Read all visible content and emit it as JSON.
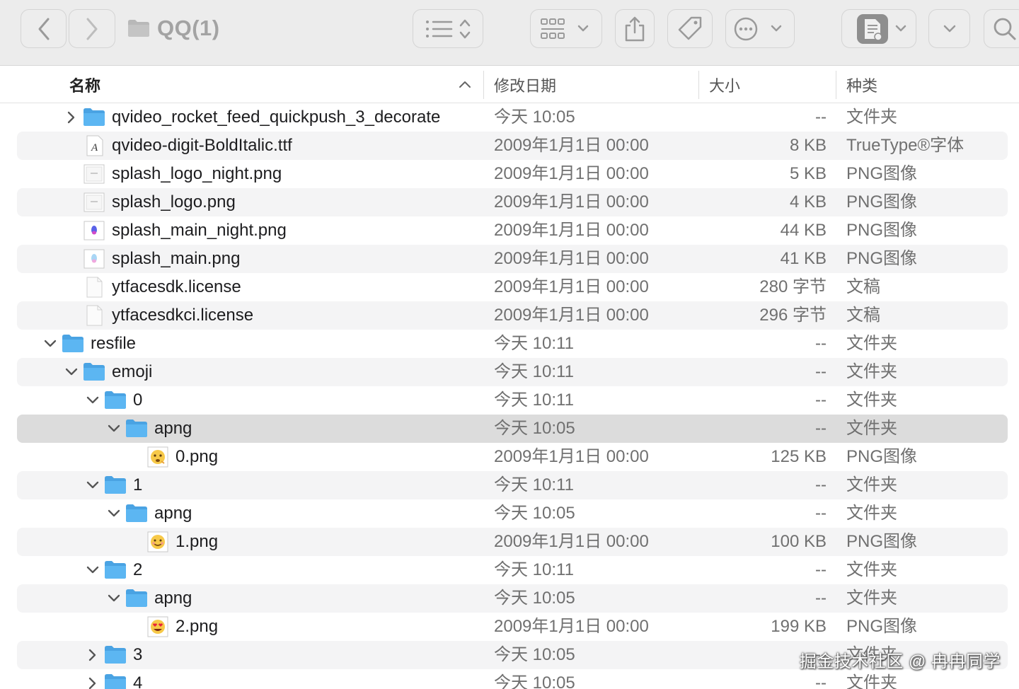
{
  "window": {
    "title": "QQ(1)",
    "toolbar": {
      "back_icon": "chevron-left-icon",
      "forward_icon": "chevron-right-icon",
      "view_icon": "list-view-icon",
      "group_icon": "grid-icon",
      "share_icon": "share-icon",
      "tag_icon": "tag-icon",
      "more_icon": "ellipsis-icon",
      "preview_icon": "document-preview-icon",
      "search_icon": "search-icon"
    }
  },
  "columns": {
    "name": "名称",
    "date": "修改日期",
    "size": "大小",
    "kind": "种类"
  },
  "colors": {
    "folder": "#5cb6f2",
    "folder_tab": "#4aa3e3",
    "selection": "#dcdcdc",
    "alt_row": "#f4f4f5"
  },
  "rows": [
    {
      "name": "qvideo_rocket_feed_quickpush_3_decorate",
      "date": "今天 10:05",
      "size": "--",
      "kind": "文件夹",
      "level": 2,
      "icon": "folder",
      "disclosure": "collapsed"
    },
    {
      "name": "qvideo-digit-BoldItalic.ttf",
      "date": "2009年1月1日 00:00",
      "size": "8 KB",
      "kind": "TrueType®字体",
      "level": 2,
      "icon": "font",
      "disclosure": "none"
    },
    {
      "name": "splash_logo_night.png",
      "date": "2009年1月1日 00:00",
      "size": "5 KB",
      "kind": "PNG图像",
      "level": 2,
      "icon": "image-plain",
      "disclosure": "none"
    },
    {
      "name": "splash_logo.png",
      "date": "2009年1月1日 00:00",
      "size": "4 KB",
      "kind": "PNG图像",
      "level": 2,
      "icon": "image-plain",
      "disclosure": "none"
    },
    {
      "name": "splash_main_night.png",
      "date": "2009年1月1日 00:00",
      "size": "44 KB",
      "kind": "PNG图像",
      "level": 2,
      "icon": "image-blue",
      "disclosure": "none"
    },
    {
      "name": "splash_main.png",
      "date": "2009年1月1日 00:00",
      "size": "41 KB",
      "kind": "PNG图像",
      "level": 2,
      "icon": "image-light",
      "disclosure": "none"
    },
    {
      "name": "ytfacesdk.license",
      "date": "2009年1月1日 00:00",
      "size": "280 字节",
      "kind": "文稿",
      "level": 2,
      "icon": "document",
      "disclosure": "none"
    },
    {
      "name": "ytfacesdkci.license",
      "date": "2009年1月1日 00:00",
      "size": "296 字节",
      "kind": "文稿",
      "level": 2,
      "icon": "document",
      "disclosure": "none"
    },
    {
      "name": "resfile",
      "date": "今天 10:11",
      "size": "--",
      "kind": "文件夹",
      "level": 1,
      "icon": "folder",
      "disclosure": "expanded"
    },
    {
      "name": "emoji",
      "date": "今天 10:11",
      "size": "--",
      "kind": "文件夹",
      "level": 2,
      "icon": "folder",
      "disclosure": "expanded"
    },
    {
      "name": "0",
      "date": "今天 10:11",
      "size": "--",
      "kind": "文件夹",
      "level": 3,
      "icon": "folder",
      "disclosure": "expanded"
    },
    {
      "name": "apng",
      "date": "今天 10:05",
      "size": "--",
      "kind": "文件夹",
      "level": 4,
      "icon": "folder",
      "disclosure": "expanded",
      "selected": true
    },
    {
      "name": "0.png",
      "date": "2009年1月1日 00:00",
      "size": "125 KB",
      "kind": "PNG图像",
      "level": 5,
      "icon": "emoji-thinking",
      "disclosure": "none"
    },
    {
      "name": "1",
      "date": "今天 10:11",
      "size": "--",
      "kind": "文件夹",
      "level": 3,
      "icon": "folder",
      "disclosure": "expanded"
    },
    {
      "name": "apng",
      "date": "今天 10:05",
      "size": "--",
      "kind": "文件夹",
      "level": 4,
      "icon": "folder",
      "disclosure": "expanded"
    },
    {
      "name": "1.png",
      "date": "2009年1月1日 00:00",
      "size": "100 KB",
      "kind": "PNG图像",
      "level": 5,
      "icon": "emoji-smile",
      "disclosure": "none"
    },
    {
      "name": "2",
      "date": "今天 10:11",
      "size": "--",
      "kind": "文件夹",
      "level": 3,
      "icon": "folder",
      "disclosure": "expanded"
    },
    {
      "name": "apng",
      "date": "今天 10:05",
      "size": "--",
      "kind": "文件夹",
      "level": 4,
      "icon": "folder",
      "disclosure": "expanded"
    },
    {
      "name": "2.png",
      "date": "2009年1月1日 00:00",
      "size": "199 KB",
      "kind": "PNG图像",
      "level": 5,
      "icon": "emoji-heart-eyes",
      "disclosure": "none"
    },
    {
      "name": "3",
      "date": "今天 10:05",
      "size": "--",
      "kind": "文件夹",
      "level": 3,
      "icon": "folder",
      "disclosure": "collapsed"
    },
    {
      "name": "4",
      "date": "今天 10:05",
      "size": "--",
      "kind": "文件夹",
      "level": 3,
      "icon": "folder",
      "disclosure": "collapsed"
    }
  ],
  "watermark": "掘金技术社区 @ 冉冉同学"
}
